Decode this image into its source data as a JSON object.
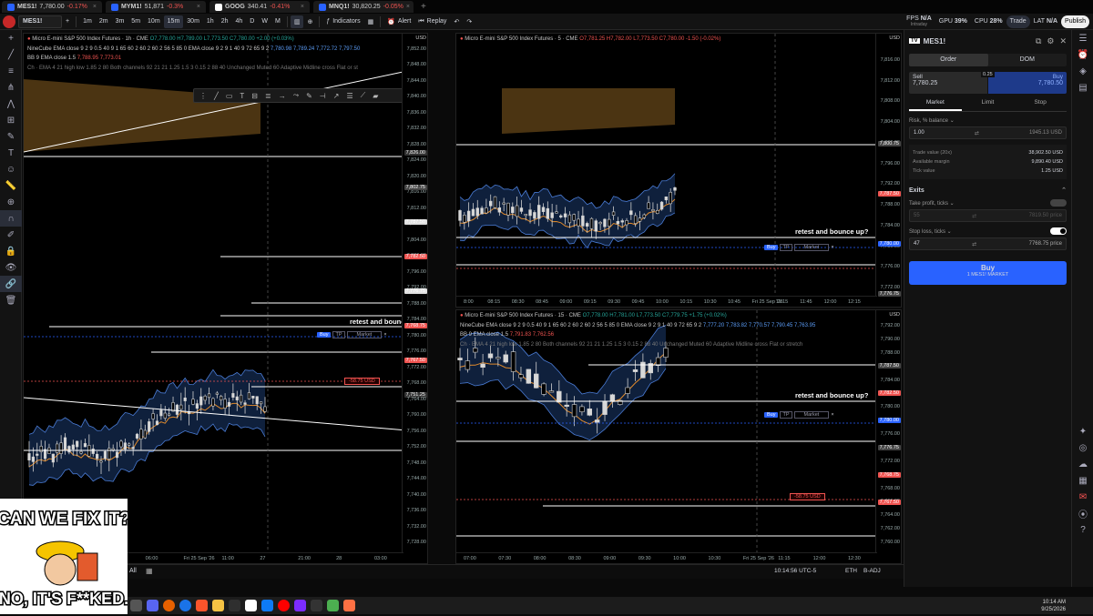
{
  "browser_tabs": [
    {
      "symbol": "MES1!",
      "price": "7,780.00",
      "change": "-0.17%"
    },
    {
      "symbol": "MYM1!",
      "price": "51,871",
      "change": "-0.3%"
    },
    {
      "symbol": "GOOG",
      "price": "340.41",
      "change": "-0.41%"
    },
    {
      "symbol": "MNQ1!",
      "price": "30,820.25",
      "change": "-0.05%"
    }
  ],
  "toolbar": {
    "symbol": "MES1!",
    "intervals": [
      "1m",
      "2m",
      "3m",
      "5m",
      "10m",
      "15m",
      "30m",
      "1h",
      "2h",
      "4h",
      "D",
      "W",
      "M"
    ],
    "active_interval": "15m",
    "indicators": "Indicators",
    "alert": "Alert",
    "replay": "Replay",
    "fps_label": "FPS",
    "fps": "N/A",
    "fps_sub": "Intraday",
    "gpu_label": "GPU",
    "gpu": "39%",
    "cpu_label": "CPU",
    "cpu": "28%",
    "lat_label": "LAT",
    "lat": "N/A",
    "trade": "Trade",
    "publish": "Publish"
  },
  "chart_left": {
    "title": "Micro E-mini S&P 500 Index Futures · 1h · CME",
    "ohlc": "O7,778.00 H7,789.00 L7,773.50 C7,780.00 +2.00 (+0.03%)",
    "ind1": "NineCube EMA close 9 2 9 0.5 40 9 1 65 60 2 60 2 60 2 56 5 85 0 EMA close 9 2 9 1 40 9 72 65 9 2",
    "ind1_vals": "7,780.98  7,789.24  7,772.72  7,797.50",
    "ind2": "BB 9 EMA close 1.5",
    "ind2_vals": "7,788.95  7,773.01",
    "ind3": "Ch · EMA 4 21 high low 1.85 2 80 Both channels 92 21 21 1.25 1.5 3 0.15 2 88 40 Unchanged Muted 60 Adaptive Midline cross Flat or st",
    "currency": "USD",
    "price_labels": [
      "7,852.00",
      "7,848.00",
      "7,844.00",
      "7,840.00",
      "7,836.00",
      "7,832.00",
      "7,828.00",
      "7,824.00",
      "7,820.00",
      "7,816.00",
      "7,812.00",
      "7,808.00",
      "7,804.00",
      "7,800.00",
      "7,796.00",
      "7,792.00",
      "7,788.00",
      "7,784.00",
      "7,780.00",
      "7,776.00",
      "7,772.00",
      "7,768.00",
      "7,764.00",
      "7,760.00",
      "7,756.00",
      "7,752.00",
      "7,748.00",
      "7,744.00",
      "7,740.00",
      "7,736.00",
      "7,732.00",
      "7,728.00"
    ],
    "time_labels": [
      "21:00",
      "25",
      "03:00",
      "06:00",
      "Fri 25 Sep '26",
      "11:00",
      "27",
      "21:00",
      "28",
      "03:00"
    ],
    "tags": [
      "7,826.00",
      "7,802.75",
      "7,787.50",
      "7,782.50",
      "7,776.75",
      "7,768.75",
      "7,767.50",
      "7,751.25"
    ],
    "annotation": "retest and bounce up?",
    "pnl": "-58.75 USD",
    "buy": "Buy",
    "tp": "TP",
    "market": "Market"
  },
  "chart_tr": {
    "title": "Micro E-mini S&P 500 Index Futures · 5 · CME",
    "ohlc": "O7,781.25 H7,782.00 L7,773.50 C7,780.00 -1.50 (-0.02%)",
    "currency": "USD",
    "price_labels": [
      "7,816.00",
      "7,812.00",
      "7,808.00",
      "7,804.00",
      "7,800.00",
      "7,796.00",
      "7,792.00",
      "7,788.00",
      "7,784.00",
      "7,780.00",
      "7,776.00",
      "7,772.00"
    ],
    "time_labels": [
      "8:00",
      "08:15",
      "08:30",
      "08:45",
      "09:00",
      "09:15",
      "09:30",
      "09:45",
      "10:00",
      "10:15",
      "10:30",
      "10:45",
      "Fri 25 Sep '26",
      "11:15",
      "11:45",
      "12:00",
      "12:15"
    ],
    "tags": [
      "7,800.75",
      "7,787.50",
      "7,780.00",
      "7,776.75"
    ],
    "annotation": "retest and bounce up?",
    "buy": "Buy",
    "tp": "TP",
    "market": "Market"
  },
  "chart_br": {
    "title": "Micro E-mini S&P 500 Index Futures · 15 · CME",
    "ohlc": "O7,778.00 H7,781.00 L7,773.50 C7,779.75 +1.75 (+0.02%)",
    "ind1": "NineCube EMA close 9 2 9 0.5 40 9 1 65 60 2 60 2 60 2 56 5 85 0 EMA close 9 2 9 1 40 9 72 65 9 2",
    "ind1_vals": "7,777.20  7,783.82  7,770.57  7,790.45  7,763.95",
    "ind2": "BB 9 EMA close 1.5",
    "ind2_vals": "7,791.83  7,762.56",
    "ind3": "Ch · EMA 4 21 high low 1.85 2 80 Both channels 92 21 21 1.25 1.5 3 0.15 2 88 40 Unchanged Muted 60 Adaptive Midline cross Flat or stretch",
    "currency": "USD",
    "price_labels": [
      "7,792.00",
      "7,790.00",
      "7,788.00",
      "7,786.00",
      "7,784.00",
      "7,782.00",
      "7,780.00",
      "7,778.00",
      "7,776.00",
      "7,774.00",
      "7,772.00",
      "7,770.00",
      "7,768.00",
      "7,766.00",
      "7,764.00",
      "7,762.00",
      "7,760.00"
    ],
    "time_labels": [
      "07:00",
      "07:30",
      "08:00",
      "08:30",
      "09:00",
      "09:30",
      "10:00",
      "10:30",
      "Fri 25 Sep '26",
      "11:15",
      "12:00",
      "12:30"
    ],
    "tags": [
      "7,787.50",
      "7,782.50",
      "7,780.00",
      "7,776.75",
      "7,768.75",
      "7,767.50"
    ],
    "annotation": "retest and bounce up?",
    "pnl": "-58.75 USD",
    "buy": "Buy",
    "tp": "TP",
    "market": "Market"
  },
  "order_panel": {
    "symbol": "MES1!",
    "tabs": [
      "Order",
      "DOM"
    ],
    "sell_label": "Sell",
    "sell_price": "7,780.25",
    "spread": "0.25",
    "buy_label": "Buy",
    "buy_price": "7,780.50",
    "order_types": [
      "Market",
      "Limit",
      "Stop"
    ],
    "risk_label": "Risk, % balance",
    "risk_value": "1.00",
    "risk_usd": "1945.13 USD",
    "trade_value_label": "Trade value (20x)",
    "trade_value": "38,902.50 USD",
    "margin_label": "Available margin",
    "margin": "9,890.40 USD",
    "tick_label": "Tick value",
    "tick": "1.25 USD",
    "exits_label": "Exits",
    "tp_label": "Take profit, ticks",
    "tp_value": "55",
    "tp_price": "7819.50 price",
    "sl_label": "Stop loss, ticks",
    "sl_value": "47",
    "sl_price": "7768.75 price",
    "submit": "Buy",
    "submit_sub": "1 MES1! MARKET"
  },
  "bottom": {
    "all": "All",
    "clock": "10:14:56 UTC-5",
    "session": "ETH",
    "adj": "B-ADJ"
  },
  "taskbar": {
    "time": "10:14 AM",
    "date": "9/25/2026"
  },
  "meme": {
    "top": "CAN WE FIX IT?",
    "bottom": "NO, IT'S F**KED."
  }
}
